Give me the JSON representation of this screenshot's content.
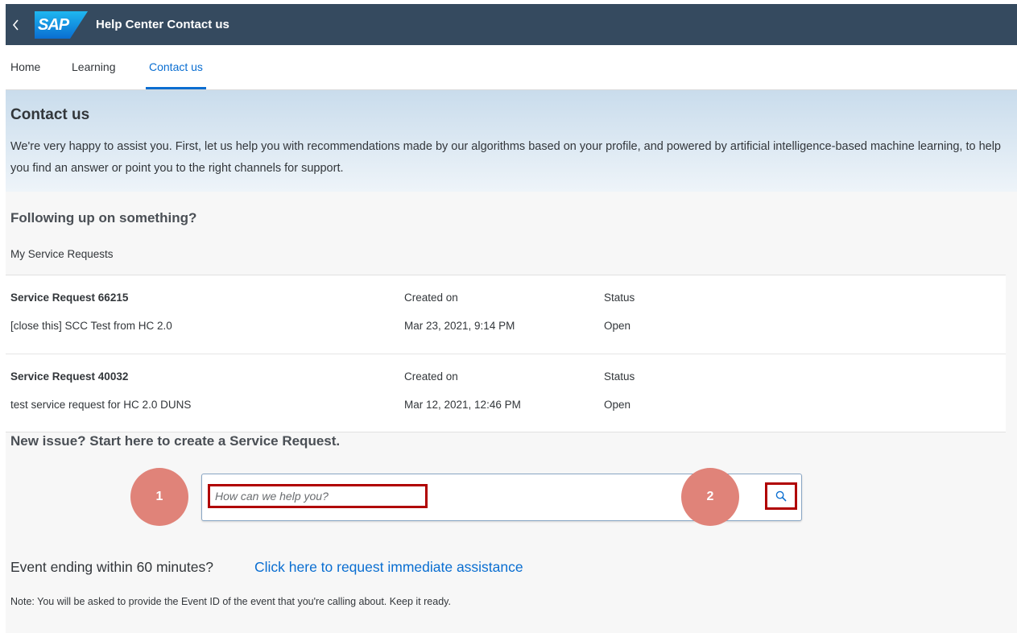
{
  "shell": {
    "logo_text": "SAP",
    "title": "Help Center Contact us"
  },
  "tabs": [
    {
      "label": "Home",
      "active": false
    },
    {
      "label": "Learning",
      "active": false
    },
    {
      "label": "Contact us",
      "active": true
    }
  ],
  "header": {
    "title": "Contact us",
    "intro": "We're very happy to assist you. First, let us help you with recommendations made by our algorithms based on your profile, and powered by artificial intelligence-based machine learning, to help you find an answer or point you to the right channels for support."
  },
  "follow_up": {
    "title": "Following up on something?",
    "list_label": "My Service Requests",
    "requests": [
      {
        "title": "Service Request 66215",
        "subtitle": "[close this] SCC Test from HC 2.0",
        "created_label": "Created on",
        "created_value": "Mar 23, 2021, 9:14 PM",
        "status_label": "Status",
        "status_value": "Open"
      },
      {
        "title": "Service Request 40032",
        "subtitle": "test service request for HC 2.0 DUNS",
        "created_label": "Created on",
        "created_value": "Mar 12, 2021, 12:46 PM",
        "status_label": "Status",
        "status_value": "Open"
      }
    ]
  },
  "new_issue": {
    "title": "New issue? Start here to create a Service Request.",
    "search_placeholder": "How can we help you?",
    "search_value": "",
    "search_icon": "search-icon"
  },
  "markers": [
    "1",
    "2"
  ],
  "event": {
    "question": "Event ending within 60 minutes?",
    "link": "Click here to request immediate assistance",
    "note": "Note: You will be asked to provide the Event ID of the event that you're calling about. Keep it ready."
  },
  "colors": {
    "shell_bg": "#354a5f",
    "accent": "#0a6ed1",
    "highlight_border": "#b00000",
    "marker": "#e08379"
  }
}
